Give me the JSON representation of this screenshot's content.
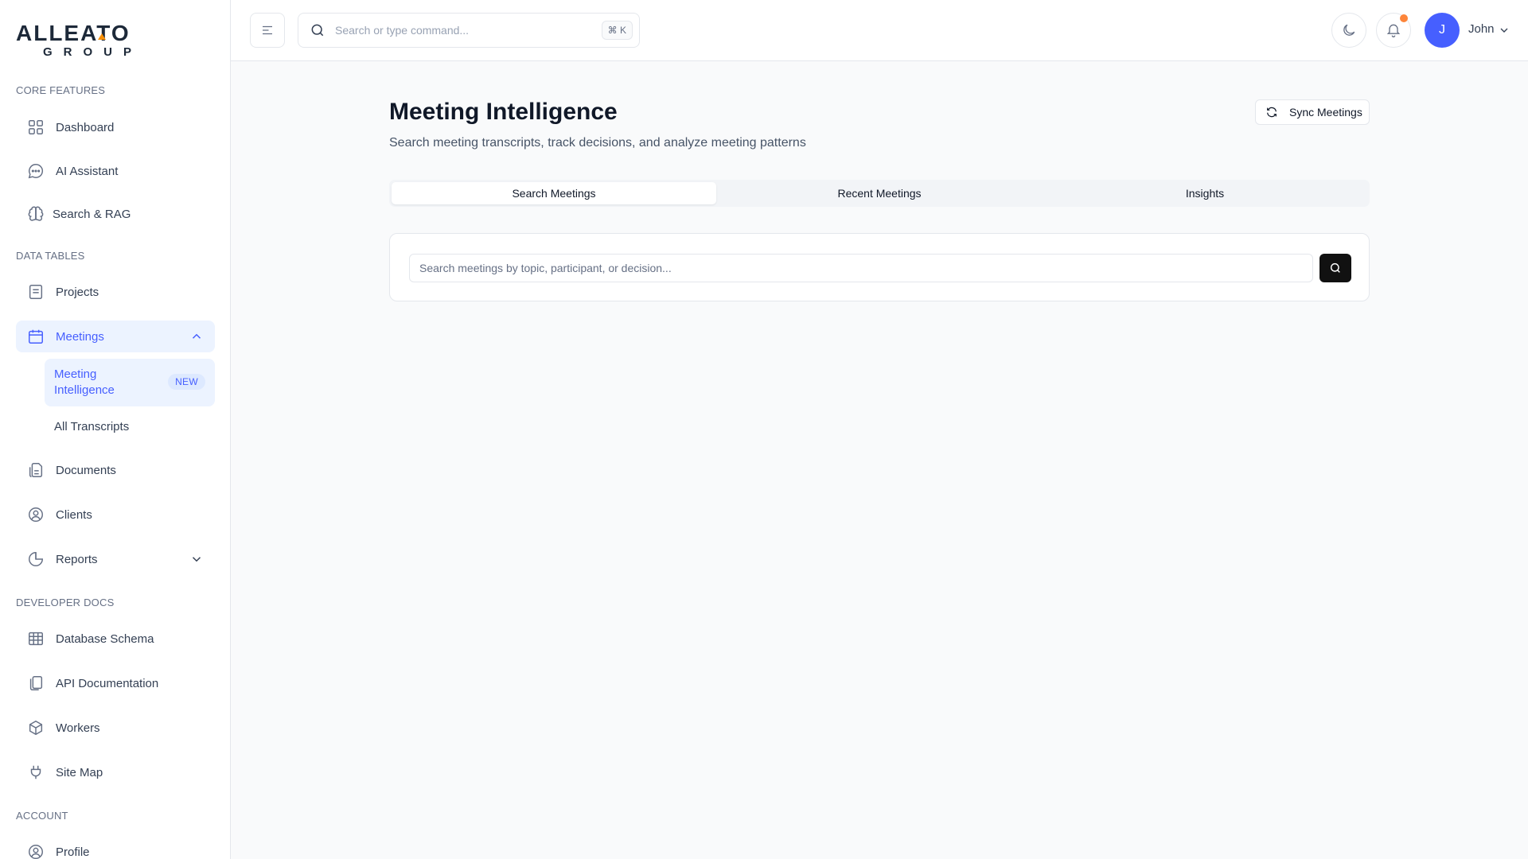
{
  "brand": {
    "name": "ALLEATO",
    "sub": "GROUP",
    "accent": "#f79009"
  },
  "colors": {
    "primary": "#465fff",
    "active_bg": "#ecf3ff",
    "notification": "#fd853a",
    "dark_button": "#111111"
  },
  "sidebar": {
    "sections": {
      "core": "CORE FEATURES",
      "data": "DATA TABLES",
      "dev": "DEVELOPER DOCS",
      "account": "ACCOUNT"
    },
    "items": {
      "dashboard": {
        "label": "Dashboard",
        "icon": "grid-icon"
      },
      "ai_assistant": {
        "label": "AI Assistant",
        "icon": "chat-icon"
      },
      "search_rag": {
        "label": "Search & RAG",
        "icon": "brain-icon"
      },
      "projects": {
        "label": "Projects",
        "icon": "list-icon"
      },
      "meetings": {
        "label": "Meetings",
        "icon": "calendar-icon",
        "expanded": true
      },
      "meeting_intelligence": {
        "label_line1": "Meeting",
        "label_line2": "Intelligence",
        "badge": "NEW"
      },
      "all_transcripts": {
        "label": "All Transcripts"
      },
      "documents": {
        "label": "Documents",
        "icon": "document-icon"
      },
      "clients": {
        "label": "Clients",
        "icon": "user-circle-icon"
      },
      "reports": {
        "label": "Reports",
        "icon": "pie-chart-icon"
      },
      "database_schema": {
        "label": "Database Schema",
        "icon": "table-icon"
      },
      "api_documentation": {
        "label": "API Documentation",
        "icon": "pages-icon"
      },
      "workers": {
        "label": "Workers",
        "icon": "box-icon"
      },
      "site_map": {
        "label": "Site Map",
        "icon": "plug-icon"
      },
      "profile": {
        "label": "Profile",
        "icon": "user-circle-icon"
      }
    }
  },
  "header": {
    "search_placeholder": "Search or type command...",
    "shortcut": "⌘ K",
    "user_initial": "J",
    "user_name": "John"
  },
  "main": {
    "title": "Meeting Intelligence",
    "subtitle": "Search meeting transcripts, track decisions, and analyze meeting patterns",
    "sync_label": "Sync Meetings",
    "tabs": [
      {
        "label": "Search Meetings",
        "active": true
      },
      {
        "label": "Recent Meetings",
        "active": false
      },
      {
        "label": "Insights",
        "active": false
      }
    ],
    "search_placeholder": "Search meetings by topic, participant, or decision..."
  }
}
